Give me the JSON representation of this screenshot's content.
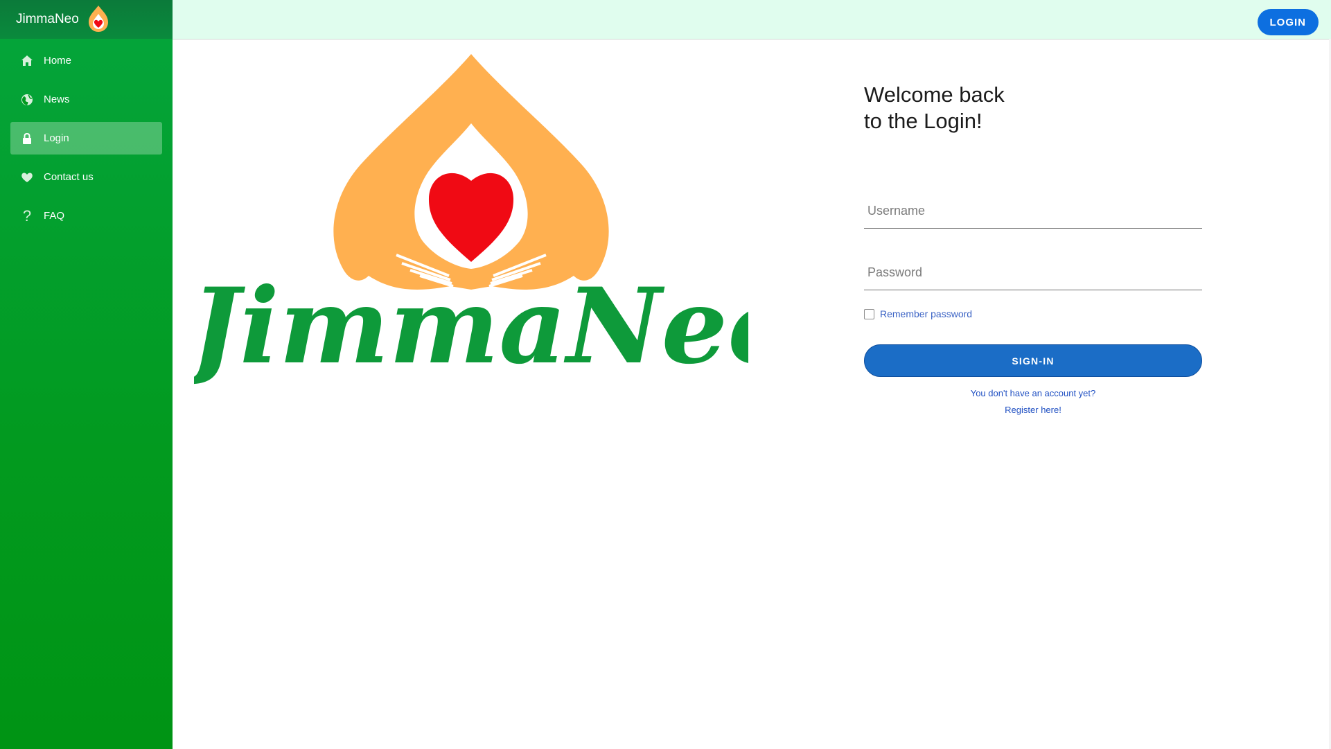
{
  "brand": {
    "name": "JimmaNeo"
  },
  "sidebar": {
    "items": [
      {
        "label": "Home",
        "icon": "home-icon"
      },
      {
        "label": "News",
        "icon": "globe-icon"
      },
      {
        "label": "Login",
        "icon": "lock-icon",
        "active": true
      },
      {
        "label": "Contact us",
        "icon": "heart-icon"
      },
      {
        "label": "FAQ",
        "icon": "question-icon"
      }
    ]
  },
  "topbar": {
    "login_label": "LOGIN"
  },
  "logo": {
    "wordmark": "JimmaNeo"
  },
  "login": {
    "title_line1": "Welcome back",
    "title_line2": "to the Login!",
    "username_placeholder": "Username",
    "password_placeholder": "Password",
    "remember_label": "Remember password",
    "signin_label": "SIGN-IN",
    "no_account_text": "You don't have an account yet?",
    "register_link": "Register here!"
  },
  "colors": {
    "sidebar_green": "#029a1f",
    "topbar_mint": "#e0fdee",
    "primary_blue": "#1b6dc6",
    "logo_orange": "#ffb050",
    "logo_red": "#f00a14",
    "wordmark_green": "#0e9a3a"
  }
}
